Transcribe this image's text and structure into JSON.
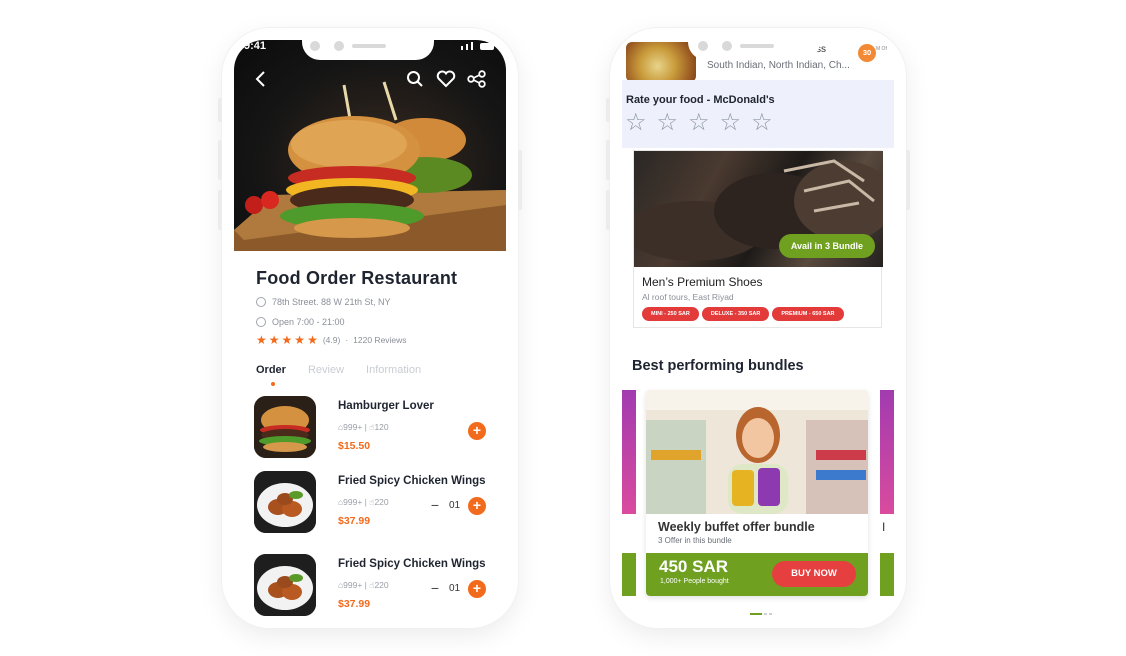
{
  "left_phone": {
    "status_time": "9:41",
    "restaurant": {
      "name": "Food Order Restaurant",
      "address": "78th Street. 88 W 21th St, NY",
      "hours": "Open 7:00 - 21:00",
      "rating": "(4.9)",
      "rating_sep": "·",
      "reviews": "1220 Reviews",
      "stars_filled": 5
    },
    "tabs": [
      "Order",
      "Review",
      "Information"
    ],
    "items": [
      {
        "name": "Hamburger Lover",
        "orders": "999+",
        "likes": "120",
        "price": "$15.50"
      },
      {
        "name": "Fried Spicy Chicken Wings",
        "orders": "999+",
        "likes": "220",
        "price": "$37.99",
        "qty": "01"
      },
      {
        "name": "Fried Spicy Chicken Wings",
        "orders": "999+",
        "likes": "220",
        "price": "$37.99",
        "qty": "01"
      }
    ],
    "plus": "+",
    "minus": "−",
    "meta_sep": "|"
  },
  "right_phone": {
    "top_item": {
      "name_fragment": "ss",
      "cuisine": "South Indian, North Indian, Ch...",
      "badge": "30",
      "badge_fragment": "M\nOf"
    },
    "rate": {
      "title": "Rate your food - McDonald's",
      "stars": 5
    },
    "shoe": {
      "title": "Men’s Premium Shoes",
      "subtitle": "Al roof tours, East Riyad",
      "avail": "Avail in 3 Bundle",
      "pills": [
        "MINI - 250 SAR",
        "DELUXE - 350 SAR",
        "PREMIUM - 650 SAR"
      ]
    },
    "section_title": "Best performing bundles",
    "bundle": {
      "title": "Weekly buffet offer bundle",
      "subtitle": "3 Offer in this bundle",
      "price": "450 SAR",
      "people": "1,000+ People bought",
      "cta": "BUY NOW"
    },
    "peek_fragment": "I"
  },
  "colors": {
    "accent_orange": "#f26a1b",
    "accent_green": "#6fa020",
    "accent_red": "#e63f3f"
  },
  "icons": [
    "back-arrow-icon",
    "search-icon",
    "heart-icon",
    "share-icon",
    "location-icon",
    "clock-icon",
    "star-icon",
    "bag-icon",
    "thumbs-up-icon"
  ]
}
